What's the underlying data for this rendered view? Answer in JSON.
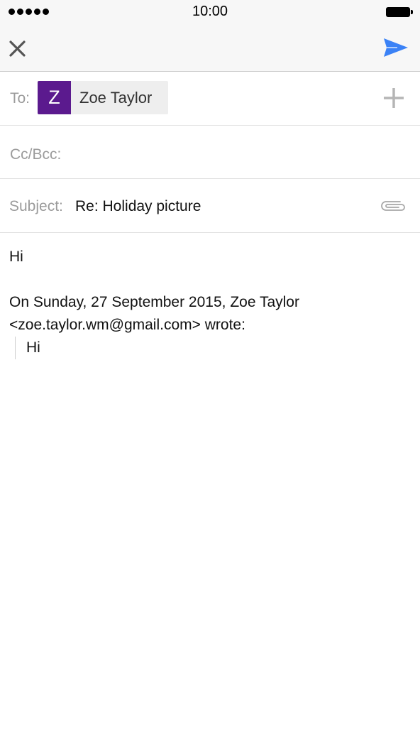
{
  "status_bar": {
    "time": "10:00",
    "signal_icon": "signal-dots-icon",
    "battery_icon": "battery-full-icon"
  },
  "nav": {
    "close_icon": "close-icon",
    "send_icon": "send-icon",
    "send_color": "#3b82f6"
  },
  "compose": {
    "to_label": "To:",
    "recipient": {
      "initial": "Z",
      "name": "Zoe Taylor",
      "avatar_color": "#5b1a8e"
    },
    "add_icon": "plus-icon",
    "cc_label": "Cc/Bcc:",
    "subject_label": "Subject:",
    "subject_value": "Re: Holiday picture",
    "attach_icon": "paperclip-icon"
  },
  "body": {
    "greeting": "Hi",
    "quote_header_line1": "On Sunday, 27 September 2015, Zoe Taylor",
    "quote_header_line2": "<zoe.taylor.wm@gmail.com> wrote:",
    "quoted_text": "Hi"
  }
}
